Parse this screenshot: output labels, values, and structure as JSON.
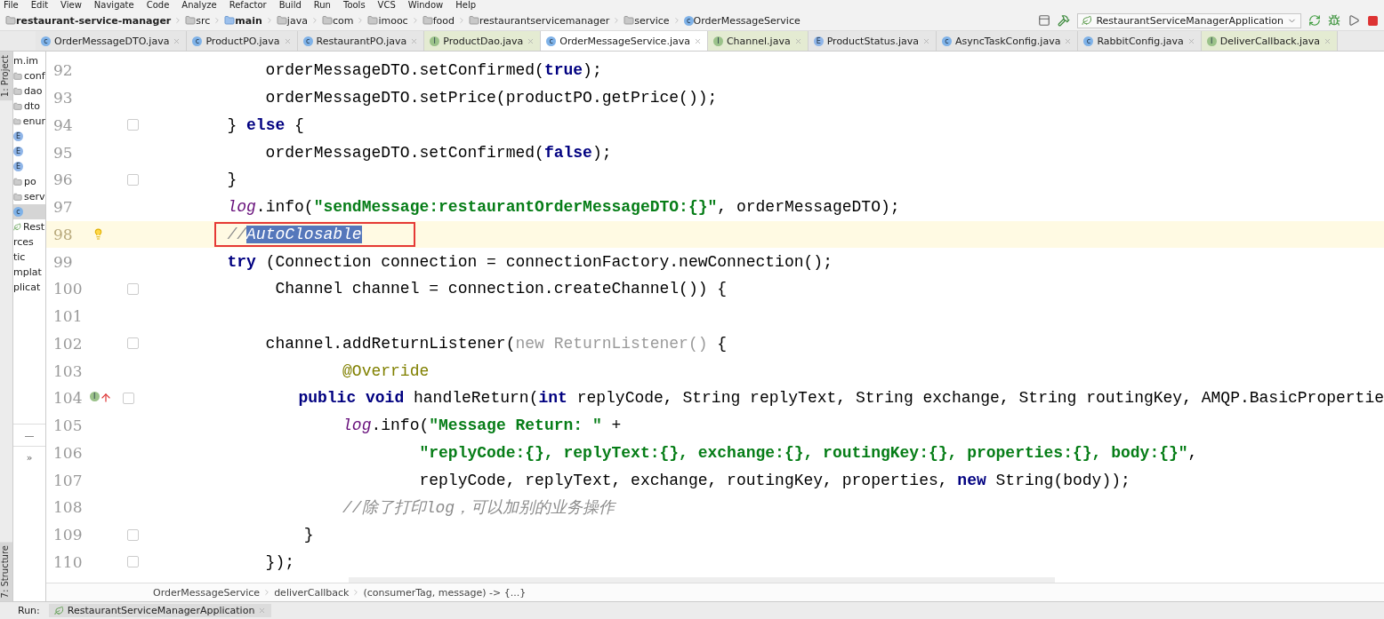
{
  "menu": [
    "File",
    "Edit",
    "View",
    "Navigate",
    "Code",
    "Analyze",
    "Refactor",
    "Build",
    "Run",
    "Tools",
    "VCS",
    "Window",
    "Help"
  ],
  "nav": [
    {
      "label": "restaurant-service-manager",
      "kind": "module"
    },
    {
      "label": "src",
      "kind": "folder"
    },
    {
      "label": "main",
      "kind": "source"
    },
    {
      "label": "java",
      "kind": "folder"
    },
    {
      "label": "com",
      "kind": "folder"
    },
    {
      "label": "imooc",
      "kind": "folder"
    },
    {
      "label": "food",
      "kind": "folder"
    },
    {
      "label": "restaurantservicemanager",
      "kind": "folder"
    },
    {
      "label": "service",
      "kind": "folder"
    },
    {
      "label": "OrderMessageService",
      "kind": "class",
      "badge": "c"
    }
  ],
  "run_config": "RestaurantServiceManagerApplication",
  "tool_strip": {
    "top": "1: Project",
    "bottom": "7: Structure"
  },
  "tabs": [
    {
      "label": "OrderMessageDTO.java",
      "kind": "class",
      "badge": "c",
      "selected": false
    },
    {
      "label": "ProductPO.java",
      "kind": "class",
      "badge": "c",
      "selected": false
    },
    {
      "label": "RestaurantPO.java",
      "kind": "class",
      "badge": "c",
      "selected": false
    },
    {
      "label": "ProductDao.java",
      "kind": "interface",
      "badge": "I",
      "selected": false
    },
    {
      "label": "OrderMessageService.java",
      "kind": "class",
      "badge": "c",
      "selected": true
    },
    {
      "label": "Channel.java",
      "kind": "interface",
      "badge": "I",
      "selected": false
    },
    {
      "label": "ProductStatus.java",
      "kind": "enum",
      "badge": "E",
      "selected": false
    },
    {
      "label": "AsyncTaskConfig.java",
      "kind": "class",
      "badge": "c",
      "selected": false
    },
    {
      "label": "RabbitConfig.java",
      "kind": "class",
      "badge": "c",
      "selected": false
    },
    {
      "label": "DeliverCallback.java",
      "kind": "interface",
      "badge": "I",
      "selected": false
    }
  ],
  "project_tree": [
    {
      "label": "m.im",
      "kind": "text",
      "selected": false
    },
    {
      "label": "conf",
      "kind": "folder",
      "selected": false
    },
    {
      "label": "dao",
      "kind": "folder",
      "selected": false
    },
    {
      "label": "dto",
      "kind": "folder",
      "selected": false
    },
    {
      "label": "enur",
      "kind": "folder",
      "selected": false
    },
    {
      "label": "E",
      "kind": "enum",
      "selected": false
    },
    {
      "label": "E",
      "kind": "enum",
      "selected": false
    },
    {
      "label": "E",
      "kind": "enum",
      "selected": false
    },
    {
      "label": "po",
      "kind": "folder",
      "selected": false
    },
    {
      "label": "serv",
      "kind": "folder",
      "selected": false
    },
    {
      "label": "c",
      "kind": "class",
      "selected": true
    },
    {
      "label": "Rest",
      "kind": "app",
      "selected": false
    },
    {
      "label": "rces",
      "kind": "text",
      "selected": false
    },
    {
      "label": "tic",
      "kind": "text",
      "selected": false
    },
    {
      "label": "mplat",
      "kind": "text",
      "selected": false
    },
    {
      "label": "plicat",
      "kind": "text",
      "selected": false
    }
  ],
  "panel_controls": [
    "—",
    "»"
  ],
  "lines": [
    {
      "number": "92",
      "current": false,
      "fold": false,
      "kind": "plain",
      "tokens": [
        {
          "text": "            orderMessageDTO.setConfirmed(",
          "kind": "plain"
        },
        {
          "text": "true",
          "kind": "kw"
        },
        {
          "text": ");",
          "kind": "plain"
        }
      ]
    },
    {
      "number": "93",
      "current": false,
      "fold": false,
      "kind": "plain",
      "tokens": [
        {
          "text": "            orderMessageDTO.setPrice(productPO.getPrice());",
          "kind": "plain"
        }
      ]
    },
    {
      "number": "94",
      "current": false,
      "fold": true,
      "kind": "plain",
      "tokens": [
        {
          "text": "        } ",
          "kind": "plain"
        },
        {
          "text": "else",
          "kind": "kw"
        },
        {
          "text": " {",
          "kind": "plain"
        }
      ]
    },
    {
      "number": "95",
      "current": false,
      "fold": false,
      "kind": "plain",
      "tokens": [
        {
          "text": "            orderMessageDTO.setConfirmed(",
          "kind": "plain"
        },
        {
          "text": "false",
          "kind": "kw"
        },
        {
          "text": ");",
          "kind": "plain"
        }
      ]
    },
    {
      "number": "96",
      "current": false,
      "fold": true,
      "kind": "plain",
      "tokens": [
        {
          "text": "        }",
          "kind": "plain"
        }
      ]
    },
    {
      "number": "97",
      "current": false,
      "fold": false,
      "kind": "plain",
      "tokens": [
        {
          "text": "        log",
          "kind": "static"
        },
        {
          "text": ".info(",
          "kind": "plain"
        },
        {
          "text": "\"sendMessage:restaurantOrderMessageDTO:{}\"",
          "kind": "str"
        },
        {
          "text": ", orderMessageDTO);",
          "kind": "plain"
        }
      ]
    },
    {
      "number": "98",
      "current": true,
      "fold": false,
      "kind": "bulb",
      "boxed": true,
      "tokens": [
        {
          "text": "        //",
          "kind": "comment"
        },
        {
          "text": "AutoClosable",
          "kind": "selection"
        }
      ]
    },
    {
      "number": "99",
      "current": false,
      "fold": false,
      "kind": "plain",
      "tokens": [
        {
          "text": "        try",
          "kind": "kw"
        },
        {
          "text": " (Connection connection = connectionFactory.newConnection();",
          "kind": "plain"
        }
      ]
    },
    {
      "number": "100",
      "current": false,
      "fold": true,
      "kind": "plain",
      "tokens": [
        {
          "text": "             Channel channel = connection.createChannel()) {",
          "kind": "plain"
        }
      ]
    },
    {
      "number": "101",
      "current": false,
      "fold": false,
      "kind": "plain"
    },
    {
      "number": "102",
      "current": false,
      "fold": true,
      "kind": "plain",
      "tokens": [
        {
          "text": "            channel.addReturnListener(",
          "kind": "plain"
        },
        {
          "text": "new ReturnListener()",
          "kind": "muted"
        },
        {
          "text": " {",
          "kind": "plain"
        }
      ]
    },
    {
      "number": "103",
      "current": false,
      "fold": false,
      "kind": "plain",
      "tokens": [
        {
          "text": "                    @Override",
          "kind": "annotation"
        }
      ]
    },
    {
      "number": "104",
      "current": false,
      "fold": true,
      "kind": "implements",
      "gutter_badge": "I",
      "tokens": [
        {
          "text": "                public void",
          "kind": "kw"
        },
        {
          "text": " handleReturn(",
          "kind": "plain"
        },
        {
          "text": "int",
          "kind": "kw"
        },
        {
          "text": " replyCode, String replyText, String exchange, String routingKey, AMQP.BasicPropertie",
          "kind": "plain"
        }
      ]
    },
    {
      "number": "105",
      "current": false,
      "fold": false,
      "kind": "plain",
      "tokens": [
        {
          "text": "                    log",
          "kind": "static"
        },
        {
          "text": ".info(",
          "kind": "plain"
        },
        {
          "text": "\"Message Return: \"",
          "kind": "str"
        },
        {
          "text": " +",
          "kind": "plain"
        }
      ]
    },
    {
      "number": "106",
      "current": false,
      "fold": false,
      "kind": "plain",
      "tokens": [
        {
          "text": "                            \"replyCode:{}, replyText:{}, exchange:{}, routingKey:{}, properties:{}, body:{}\"",
          "kind": "str"
        },
        {
          "text": ",",
          "kind": "plain"
        }
      ]
    },
    {
      "number": "107",
      "current": false,
      "fold": false,
      "kind": "plain",
      "tokens": [
        {
          "text": "                            replyCode, replyText, exchange, routingKey, properties, ",
          "kind": "plain"
        },
        {
          "text": "new",
          "kind": "kw"
        },
        {
          "text": " String(body));",
          "kind": "plain"
        }
      ]
    },
    {
      "number": "108",
      "current": false,
      "fold": false,
      "kind": "plain",
      "tokens": [
        {
          "text": "                    //除了打印log，可以加别的业务操作",
          "kind": "comment"
        }
      ]
    },
    {
      "number": "109",
      "current": false,
      "fold": true,
      "kind": "plain",
      "tokens": [
        {
          "text": "                }",
          "kind": "plain"
        }
      ]
    },
    {
      "number": "110",
      "current": false,
      "fold": true,
      "kind": "plain",
      "tokens": [
        {
          "text": "            });",
          "kind": "plain"
        }
      ]
    }
  ],
  "breadcrumbs": [
    "OrderMessageService",
    "deliverCallback",
    "(consumerTag, message) -> {...}"
  ],
  "run_bar": {
    "label": "Run:",
    "tab": "RestaurantServiceManagerApplication"
  }
}
